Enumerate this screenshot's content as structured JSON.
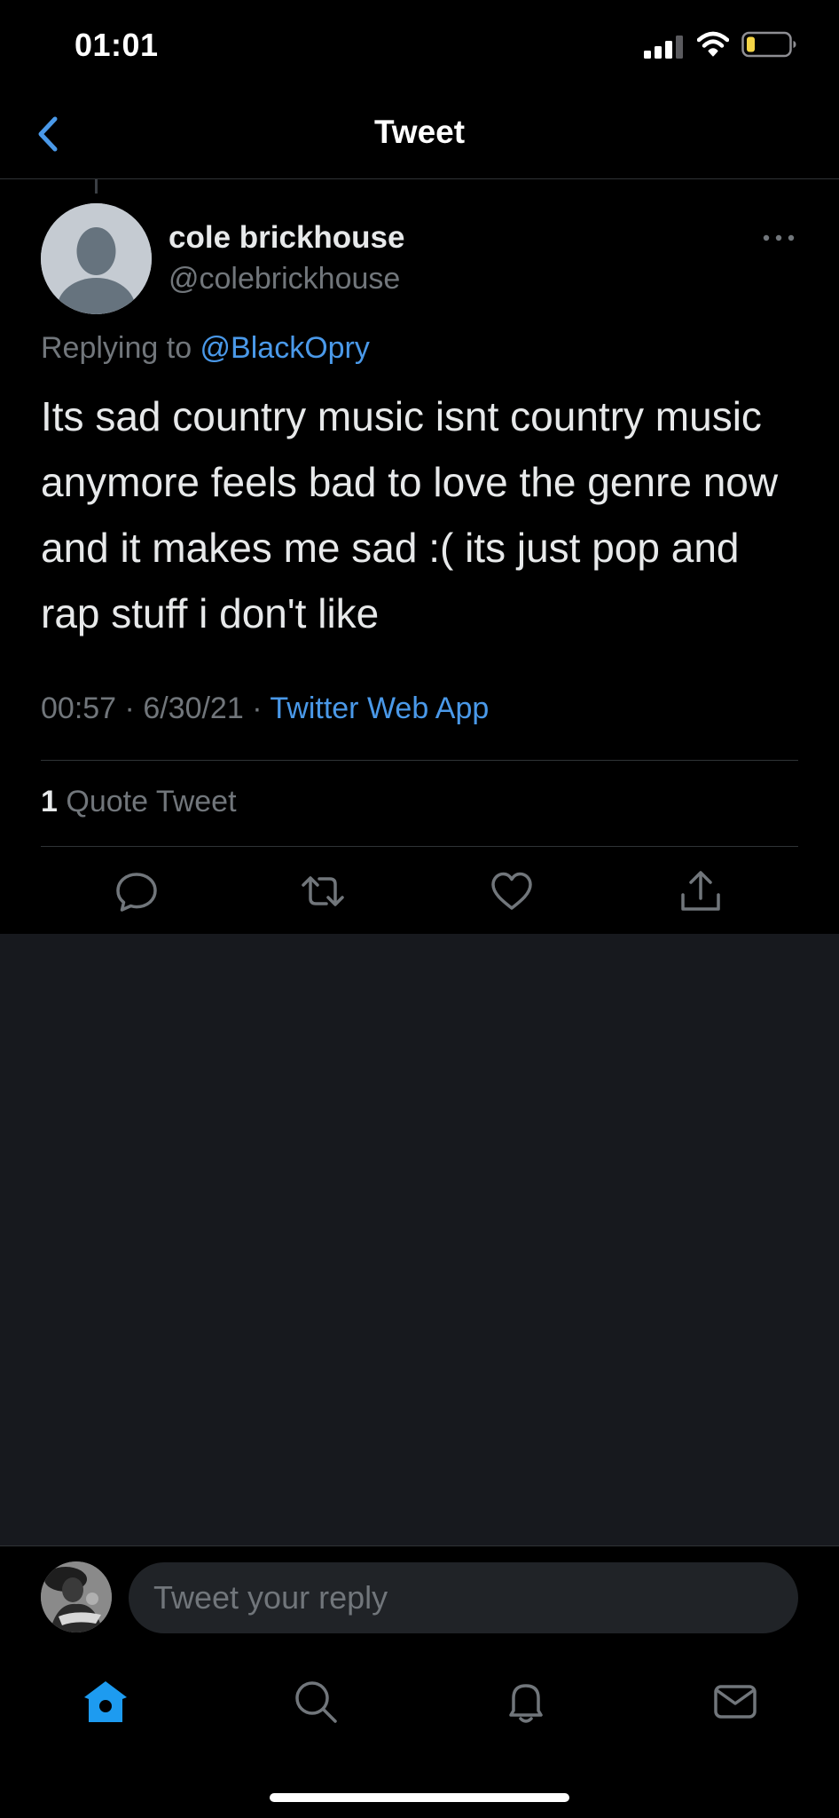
{
  "status_bar": {
    "time": "01:01",
    "icons": [
      "signal-icon",
      "wifi-icon",
      "battery-icon"
    ]
  },
  "header": {
    "title": "Tweet",
    "back_icon": "chevron-left-icon"
  },
  "tweet": {
    "author_name": "cole brickhouse",
    "author_handle": "@colebrickhouse",
    "replying_prefix": "Replying to ",
    "replying_to": "@BlackOpry",
    "text": "Its sad country music isnt country music anymore feels bad to love the genre now and it makes me sad :( its just pop and rap stuff i don't like",
    "time": "00:57",
    "date": "6/30/21",
    "source": "Twitter Web App",
    "quote_count": "1",
    "quote_label": "Quote Tweet",
    "actions": [
      "reply-icon",
      "retweet-icon",
      "like-icon",
      "share-icon"
    ]
  },
  "composer": {
    "placeholder": "Tweet your reply"
  },
  "tab_bar": {
    "items": [
      "home-icon",
      "search-icon",
      "notifications-icon",
      "messages-icon"
    ],
    "active": "home"
  },
  "colors": {
    "background": "#000000",
    "lower_background": "#17191e",
    "accent": "#4a99e9",
    "secondary_text": "#71767b",
    "divider": "#2f3336"
  }
}
